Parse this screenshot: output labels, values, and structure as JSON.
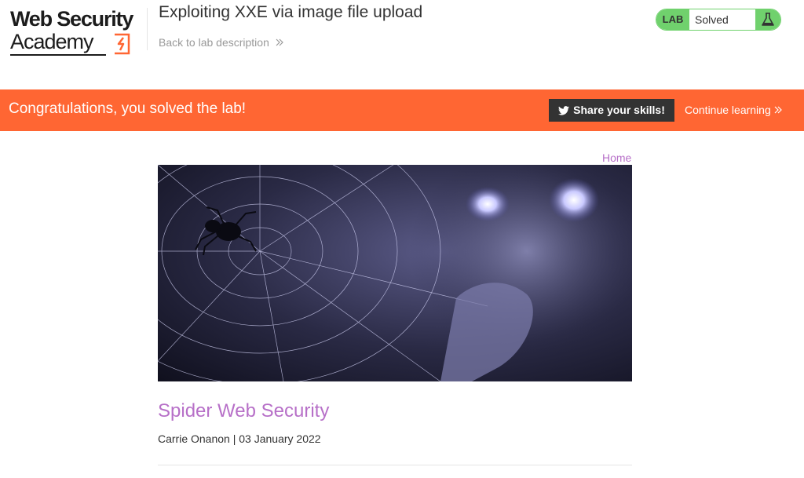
{
  "header": {
    "logo_line1": "Web Security",
    "logo_line2": "Academy",
    "lab_title": "Exploiting XXE via image file upload",
    "back_link": "Back to lab description",
    "lab_status": {
      "tag": "LAB",
      "state": "Solved"
    }
  },
  "banner": {
    "message": "Congratulations, you solved the lab!",
    "share_label": "Share your skills!",
    "continue_label": "Continue learning"
  },
  "nav": {
    "home": "Home"
  },
  "post": {
    "title": "Spider Web Security",
    "author": "Carrie Onanon",
    "separator": "|",
    "date": "03 January 2022"
  },
  "colors": {
    "accent_orange": "#ff6633",
    "solved_green": "#70d16d",
    "link_purple": "#b770c8",
    "dark_button": "#333333"
  }
}
